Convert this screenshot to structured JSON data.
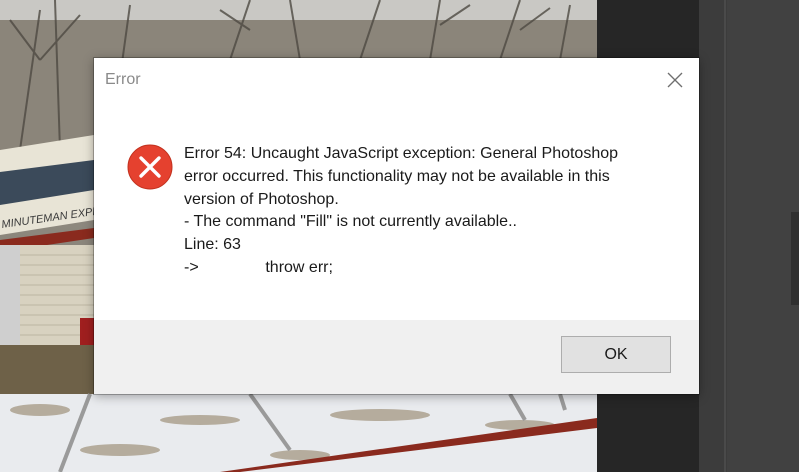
{
  "dialog": {
    "title": "Error",
    "close_icon": "close-icon",
    "error_icon": "error-circle-x-icon",
    "message_lines": [
      "Error 54: Uncaught JavaScript exception: General Photoshop",
      "error occurred. This functionality may not be available in this",
      "version of Photoshop.",
      "- The command \"Fill\" is not currently available..",
      "Line: 63",
      "->               throw err;"
    ],
    "ok_label": "OK"
  },
  "background": {
    "sign_text": "MINUTEMAN EXPRES"
  },
  "colors": {
    "error_red": "#e5412f",
    "dialog_bg": "#ffffff",
    "footer_bg": "#f0f0f0",
    "button_bg": "#e1e1e1",
    "button_border": "#adadad"
  }
}
